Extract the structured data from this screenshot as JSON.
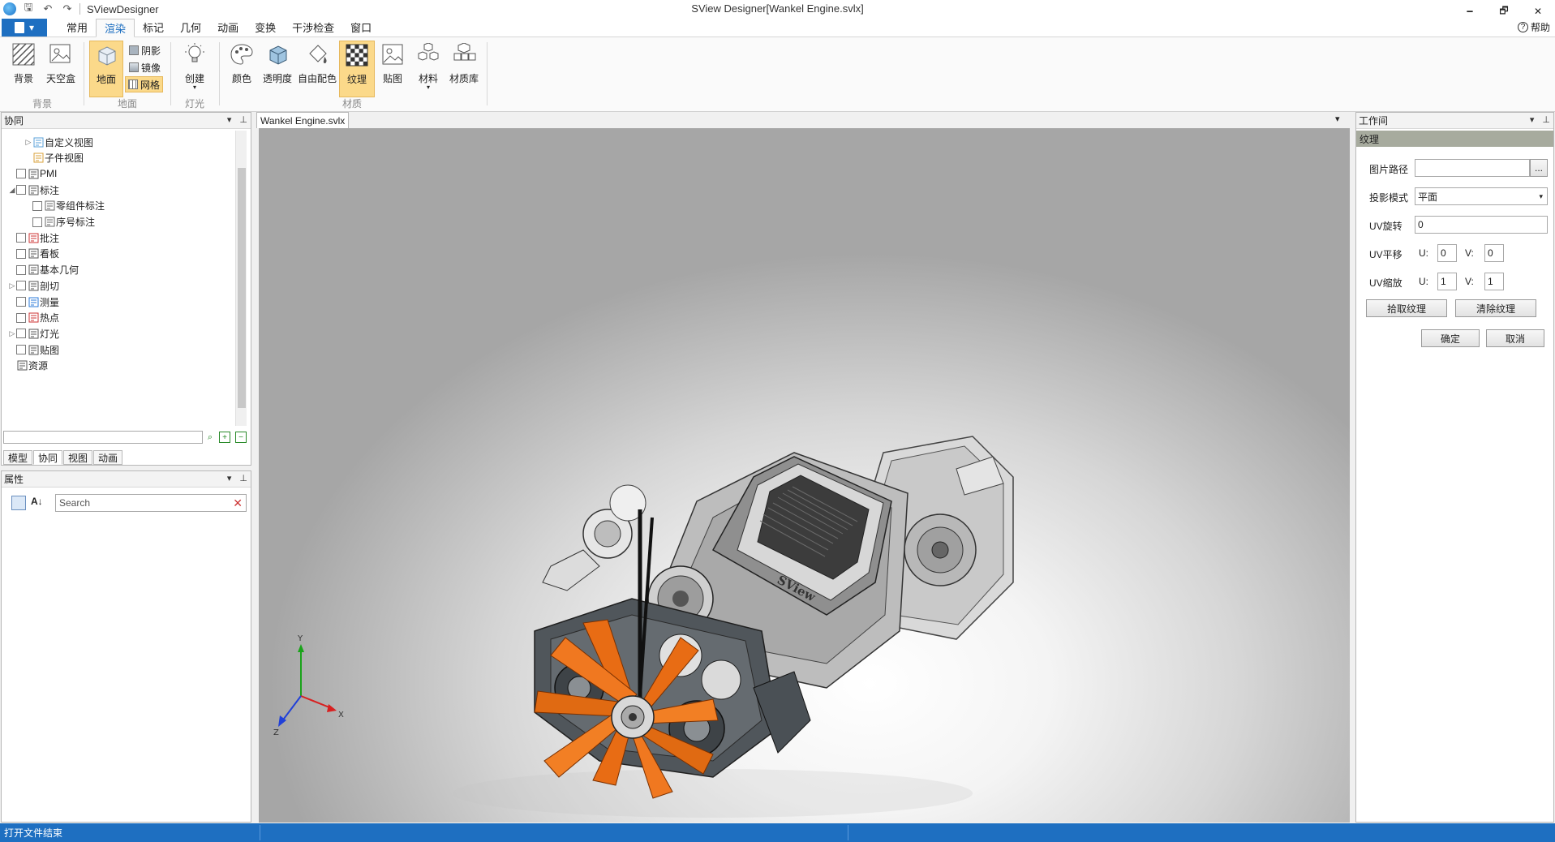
{
  "window": {
    "app_name": "SViewDesigner",
    "title": "SView Designer[Wankel Engine.svlx]",
    "minimize_glyph": "🗕",
    "restore_glyph": "🗗",
    "close_glyph": "✕"
  },
  "ribbon_tabs": [
    "常用",
    "渲染",
    "标记",
    "几何",
    "动画",
    "变换",
    "干涉检查",
    "窗口"
  ],
  "active_tab": "渲染",
  "help_label": "帮助",
  "ribbon": {
    "background_label": "背景",
    "skybox_label": "天空盒",
    "ground_label": "地面",
    "shadow_label": "阴影",
    "mirror_label": "镜像",
    "grid_label": "网格",
    "create_label": "创建",
    "color_label": "颜色",
    "transparency_label": "透明度",
    "free_color_label": "自由配色",
    "texture_label": "纹理",
    "decal_label": "贴图",
    "material_label": "材料",
    "material_lib_label": "材质库",
    "groups": {
      "background": "背景",
      "ground": "地面",
      "light": "灯光",
      "material": "材质"
    }
  },
  "collab_panel": {
    "title": "协同",
    "tree": [
      {
        "label": "自定义视图",
        "indent": 1,
        "expander": "▷",
        "checkbox": false
      },
      {
        "label": "子件视图",
        "indent": 1,
        "expander": "",
        "checkbox": false
      },
      {
        "label": "PMI",
        "indent": 0,
        "expander": "",
        "checkbox": true
      },
      {
        "label": "标注",
        "indent": 0,
        "expander": "◢",
        "checkbox": true
      },
      {
        "label": "零组件标注",
        "indent": 1,
        "expander": "",
        "checkbox": true
      },
      {
        "label": "序号标注",
        "indent": 1,
        "expander": "",
        "checkbox": true
      },
      {
        "label": "批注",
        "indent": 0,
        "expander": "",
        "checkbox": true
      },
      {
        "label": "看板",
        "indent": 0,
        "expander": "",
        "checkbox": true
      },
      {
        "label": "基本几何",
        "indent": 0,
        "expander": "",
        "checkbox": true
      },
      {
        "label": "剖切",
        "indent": 0,
        "expander": "▷",
        "checkbox": true
      },
      {
        "label": "测量",
        "indent": 0,
        "expander": "",
        "checkbox": true
      },
      {
        "label": "热点",
        "indent": 0,
        "expander": "",
        "checkbox": true
      },
      {
        "label": "灯光",
        "indent": 0,
        "expander": "▷",
        "checkbox": true
      },
      {
        "label": "贴图",
        "indent": 0,
        "expander": "",
        "checkbox": true
      },
      {
        "label": "资源",
        "indent": 0,
        "expander": "",
        "checkbox": false
      }
    ],
    "bottom_tabs": [
      "模型",
      "协同",
      "视图",
      "动画"
    ],
    "active_bottom_tab": "协同"
  },
  "properties_panel": {
    "title": "属性",
    "search_placeholder": "Search"
  },
  "document_tab": "Wankel Engine.svlx",
  "viewport": {
    "axis_x": "X",
    "axis_y": "Y",
    "axis_z": "Z",
    "logo_text": "SView"
  },
  "workspace_panel": {
    "title": "工作间",
    "section": "纹理",
    "image_path_label": "图片路径",
    "image_path_value": "",
    "browse_label": "...",
    "projection_label": "投影模式",
    "projection_value": "平面",
    "uv_rotate_label": "UV旋转",
    "uv_rotate_value": "0",
    "uv_offset_label": "UV平移",
    "uv_offset_u": "0",
    "uv_offset_v": "0",
    "uv_scale_label": "UV缩放",
    "uv_scale_u": "1",
    "uv_scale_v": "1",
    "u_label": "U:",
    "v_label": "V:",
    "pick_texture_label": "拾取纹理",
    "clear_texture_label": "清除纹理",
    "ok_label": "确定",
    "cancel_label": "取消"
  },
  "status": {
    "message": "打开文件结束"
  },
  "colors": {
    "accent": "#1e6fc1",
    "active_button": "#fbd98a",
    "fan_orange": "#f07820",
    "engine_gray": "#5a5f63"
  }
}
